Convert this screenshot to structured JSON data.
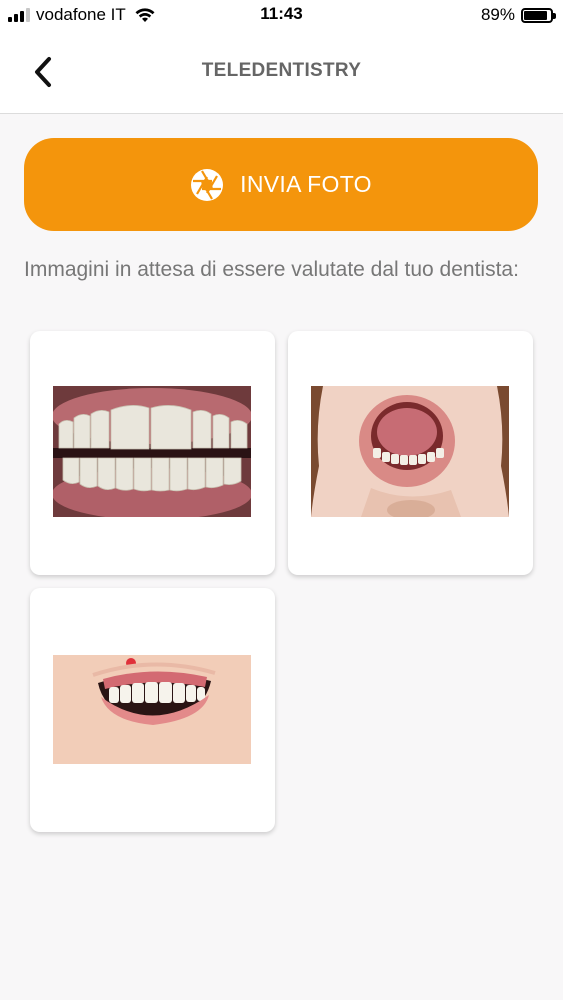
{
  "status_bar": {
    "carrier": "vodafone IT",
    "time": "11:43",
    "battery_percent": "89%",
    "battery_level": 0.89,
    "signal_bars_filled": 3,
    "signal_bars_total": 4
  },
  "header": {
    "title": "TELEDENTISTRY",
    "back_icon": "chevron-left-icon"
  },
  "send_button": {
    "label": "INVIA FOTO",
    "icon": "camera-shutter-icon",
    "color": "#f4950c"
  },
  "pending_text": "Immagini in attesa di essere valutate dal tuo dentista:",
  "photos": [
    {
      "description_icon": "teeth-closeup-photo"
    },
    {
      "description_icon": "open-mouth-photo"
    },
    {
      "description_icon": "smile-gum-photo"
    }
  ]
}
